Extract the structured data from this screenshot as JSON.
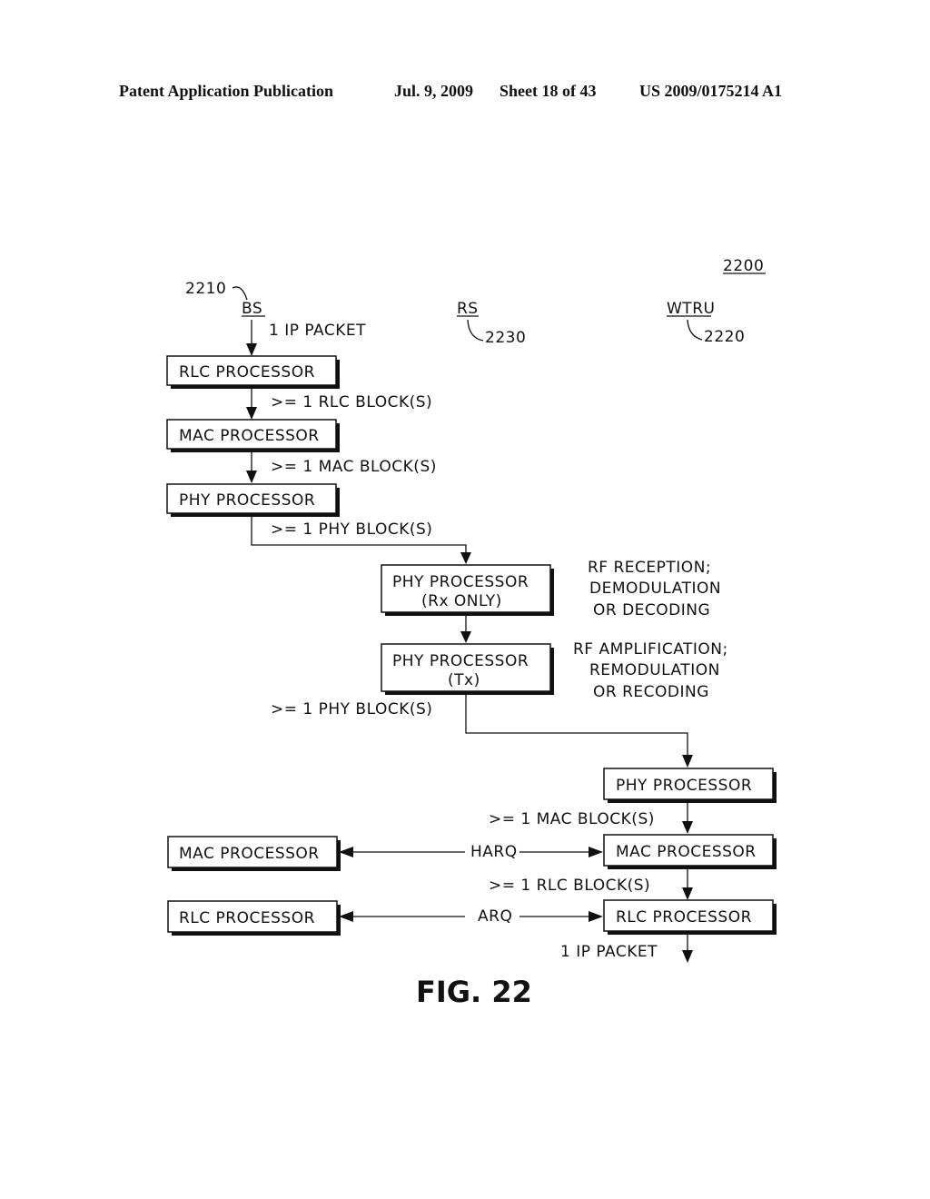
{
  "header": {
    "publication": "Patent Application Publication",
    "date": "Jul. 9, 2009",
    "sheet": "Sheet 18 of 43",
    "number": "US 2009/0175214 A1"
  },
  "diagram": {
    "ref_number": "2200",
    "figure_label": "FIG. 22",
    "entities": {
      "bs": {
        "label": "BS",
        "ref": "2210"
      },
      "rs": {
        "label": "RS",
        "ref": "2230"
      },
      "wtru": {
        "label": "WTRU",
        "ref": "2220"
      }
    },
    "bs_boxes": {
      "rlc": "RLC PROCESSOR",
      "mac": "MAC PROCESSOR",
      "phy": "PHY PROCESSOR",
      "mac_lower": "MAC PROCESSOR",
      "rlc_lower": "RLC PROCESSOR"
    },
    "rs_boxes": {
      "phy_rx_line1": "PHY PROCESSOR",
      "phy_rx_line2": "(Rx ONLY)",
      "phy_tx_line1": "PHY PROCESSOR",
      "phy_tx_line2": "(Tx)"
    },
    "wtru_boxes": {
      "phy": "PHY PROCESSOR",
      "mac": "MAC PROCESSOR",
      "rlc": "RLC PROCESSOR"
    },
    "flow_labels": {
      "ip_in": "1 IP PACKET",
      "rlc_blocks": ">= 1 RLC BLOCK(S)",
      "mac_blocks": ">= 1 MAC BLOCK(S)",
      "phy_blocks": ">= 1 PHY BLOCK(S)",
      "phy_blocks_rs": ">= 1 PHY BLOCK(S)",
      "wtru_mac_blocks": ">= 1 MAC BLOCK(S)",
      "wtru_rlc_blocks": ">= 1 RLC BLOCK(S)",
      "ip_out": "1 IP PACKET",
      "harq": "HARQ",
      "arq": "ARQ"
    },
    "rs_notes": {
      "rx_line1": "RF RECEPTION;",
      "rx_line2": "DEMODULATION",
      "rx_line3": "OR DECODING",
      "tx_line1": "RF AMPLIFICATION;",
      "tx_line2": "REMODULATION",
      "tx_line3": "OR RECODING"
    }
  }
}
